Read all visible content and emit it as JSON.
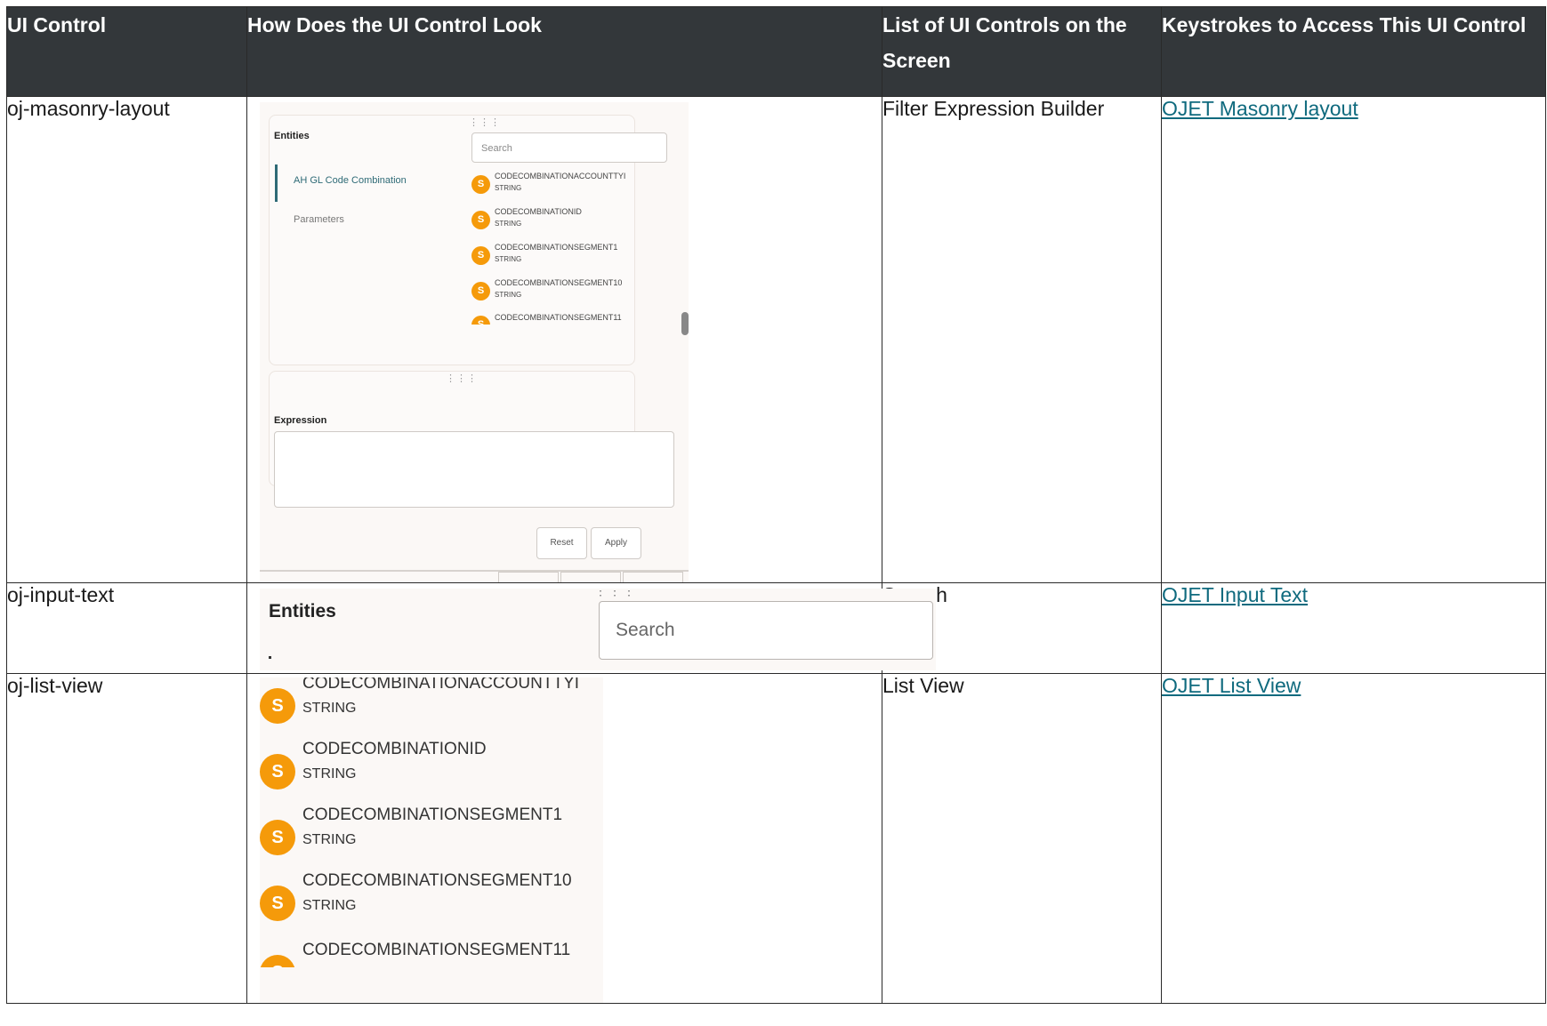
{
  "table": {
    "headers": [
      "UI Control",
      "How Does the UI Control Look",
      "List of UI Controls on the Screen",
      "Keystrokes to Access This UI Control"
    ],
    "rows": [
      {
        "control": "oj-masonry-layout",
        "list": "Filter Expression Builder",
        "link": "OJET Masonry layout"
      },
      {
        "control": "oj-input-text",
        "list": "Search",
        "link": "OJET Input Text"
      },
      {
        "control": "oj-list-view",
        "list": "List View",
        "link": "OJET List View"
      }
    ]
  },
  "masonry_shot": {
    "entities_label": "Entities",
    "nav_items": [
      "AH GL Code Combination",
      "Parameters"
    ],
    "search_placeholder": "Search",
    "items": [
      {
        "badge": "S",
        "name": "CODECOMBINATIONACCOUNTTYI",
        "type": "STRING"
      },
      {
        "badge": "S",
        "name": "CODECOMBINATIONID",
        "type": "STRING"
      },
      {
        "badge": "S",
        "name": "CODECOMBINATIONSEGMENT1",
        "type": "STRING"
      },
      {
        "badge": "S",
        "name": "CODECOMBINATIONSEGMENT10",
        "type": "STRING"
      },
      {
        "badge": "S",
        "name": "CODECOMBINATIONSEGMENT11",
        "type": ""
      }
    ],
    "expression_label": "Expression",
    "reset_label": "Reset",
    "apply_label": "Apply"
  },
  "input_shot": {
    "entities_label": "Entities",
    "search_placeholder": "Search"
  },
  "list_shot": {
    "items": [
      {
        "badge": "S",
        "name": "CODECOMBINATIONACCOUNTTYI",
        "type": "STRING"
      },
      {
        "badge": "S",
        "name": "CODECOMBINATIONID",
        "type": "STRING"
      },
      {
        "badge": "S",
        "name": "CODECOMBINATIONSEGMENT1",
        "type": "STRING"
      },
      {
        "badge": "S",
        "name": "CODECOMBINATIONSEGMENT10",
        "type": "STRING"
      },
      {
        "badge": "S",
        "name": "CODECOMBINATIONSEGMENT11",
        "type": ""
      }
    ]
  },
  "colors": {
    "header_bg": "#33373a",
    "link": "#0f6a7e",
    "badge": "#f59a0a",
    "accent": "#2e6a76"
  }
}
